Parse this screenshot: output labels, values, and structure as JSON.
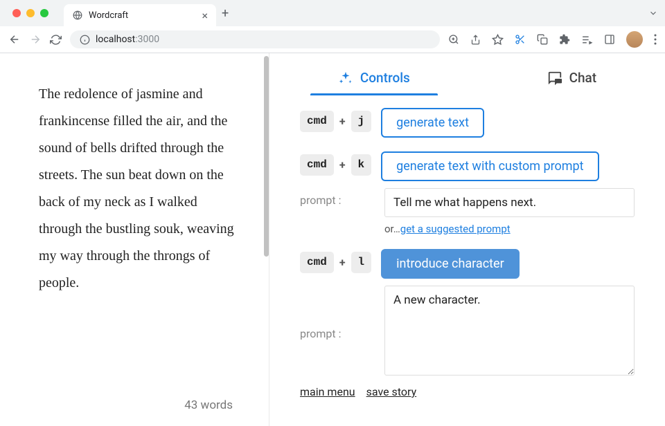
{
  "browser": {
    "tab_title": "Wordcraft",
    "url_host": "localhost",
    "url_port": ":3000"
  },
  "story": {
    "text": " The redolence of jasmine and frankincense filled the air, and the sound of bells drifted through the streets. The sun beat down on the back of my neck as I walked through the bustling souk, weaving my way through the throngs of people.",
    "word_count": "43 words"
  },
  "tabs": {
    "controls": "Controls",
    "chat": "Chat"
  },
  "controls": {
    "cmd_key": "cmd",
    "j_key": "j",
    "k_key": "k",
    "l_key": "l",
    "plus": "+",
    "generate_text": "generate text",
    "generate_custom": "generate text with custom prompt",
    "introduce_character": "introduce character",
    "prompt_label": "prompt :",
    "prompt_value_1": "Tell me what happens next.",
    "or_text": "or…",
    "suggested_link": "get a suggested prompt",
    "prompt_value_2": "A new character."
  },
  "footer": {
    "main_menu": "main menu",
    "save_story": "save story"
  }
}
